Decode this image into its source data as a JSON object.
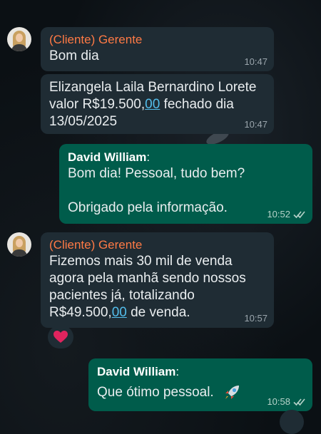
{
  "messages": {
    "m1": {
      "sender": "(Cliente) Gerente",
      "text": "Bom dia",
      "time": "10:47"
    },
    "m2": {
      "line1": "Elizangela Laila Bernardino Lorete",
      "line2_pre": "valor R$19.500,",
      "line2_link": "00",
      "line2_post": " fechado dia",
      "line3": "13/05/2025",
      "time": "10:47"
    },
    "m3": {
      "author": "David William",
      "author_sep": ":",
      "line1": "Bom dia! Pessoal, tudo bem?",
      "line2": "Obrigado pela informação.",
      "time": "10:52"
    },
    "m4": {
      "sender": "(Cliente) Gerente",
      "line1": "Fizemos mais 30 mil de venda",
      "line2": "agora pela manhã sendo nossos",
      "line3": "pacientes já, totalizando",
      "line4_pre": "R$49.500,",
      "line4_link": "00",
      "line4_post": " de venda.",
      "time": "10:57",
      "reaction_icon": "heart-icon"
    },
    "m5": {
      "author": "David William",
      "author_sep": ":",
      "text": "Que ótimo pessoal.",
      "emoji_icon": "rocket-icon",
      "time": "10:58"
    }
  },
  "colors": {
    "incoming_bubble": "#1f2c34",
    "outgoing_bubble": "#005c4b",
    "sender_name": "#ff7a45",
    "link": "#53bdeb",
    "background": "#0b1014"
  }
}
